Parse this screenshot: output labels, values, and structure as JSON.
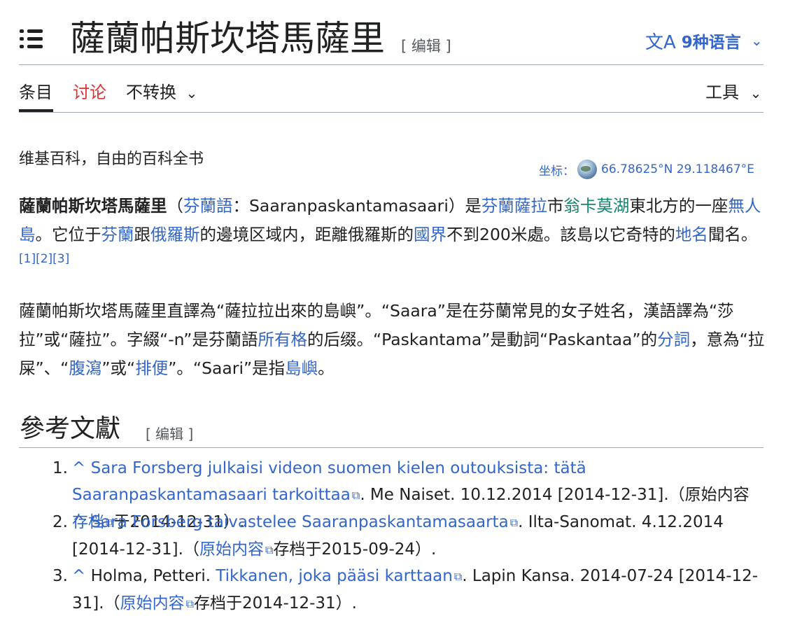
{
  "header": {
    "title": "薩蘭帕斯坎塔馬薩里",
    "edit_label": "[ 编辑 ]",
    "languages_label": "9种语言"
  },
  "tabs": {
    "article": "条目",
    "talk": "讨论",
    "variant": "不转换",
    "tools": "工具"
  },
  "tagline": "维基百科，自由的百科全书",
  "coordinates": {
    "label": "坐标：",
    "value": "66.78625°N 29.118467°E"
  },
  "intro": {
    "t1": "薩蘭帕斯坎塔馬薩里",
    "t2": "（",
    "l1": "芬蘭語",
    "t3": "：Saaranpaskantamasaari）是",
    "l2": "芬蘭薩拉",
    "t4": "市",
    "l3": "翁卡莫湖",
    "t5": "東北方的一座",
    "l4": "無人島",
    "t6": "。它位于",
    "l5": "芬蘭",
    "t7": "跟",
    "l6": "俄羅斯",
    "t8": "的邊境区域内，距離俄羅斯的",
    "l7": "國界",
    "t9": "不到200米處。該島以它奇特的",
    "l8": "地名",
    "t10": "聞名。",
    "refs": "[1][2][3]"
  },
  "etymology": {
    "t1": "薩蘭帕斯坎塔馬薩里直譯為“薩拉拉出來的島嶼”。“Saara”是在芬蘭常見的女子姓名，漢語譯為“莎拉”或“薩拉”。字綴“-n”是芬蘭語",
    "l1": "所有格",
    "t2": "的后缀。“Paskantama”是動詞“Paskantaa”的",
    "l2": "分詞",
    "t3": "，意為“拉屎”、“",
    "l3": "腹瀉",
    "t4": "”或“",
    "l4": "排便",
    "t5": "”。“Saari”是指",
    "l5": "島嶼",
    "t6": "。"
  },
  "references": {
    "heading": "參考文獻",
    "edit_label": "[ 编辑 ]",
    "items": [
      {
        "num": "1.",
        "caret": "^",
        "title": "Sara Forsberg julkaisi videon suomen kielen outouksista: tätä Saaranpaskantamasaari tarkoittaa",
        "rest1": ". Me Naiset. 10.12.2014 [2014-12-31].（原始内容",
        "archive": "存档",
        "rest2": "于2014-12-31）."
      },
      {
        "num": "2.",
        "caret": "^",
        "title": "Sara Forsberg taivastelee Saaranpaskantamasaarta",
        "rest1": ". Ilta-Sanomat. 4.12.2014 [2014-12-31].（",
        "archive": "原始内容",
        "rest2": "存档于2015-09-24）."
      },
      {
        "num": "3.",
        "caret": "^",
        "author": "Holma, Petteri.",
        "title": "Tikkanen, joka pääsi karttaan",
        "rest1": ". Lapin Kansa. 2014-07-24 [2014-12-31].（",
        "archive": "原始内容",
        "rest2": "存档于2014-12-31）."
      }
    ]
  }
}
